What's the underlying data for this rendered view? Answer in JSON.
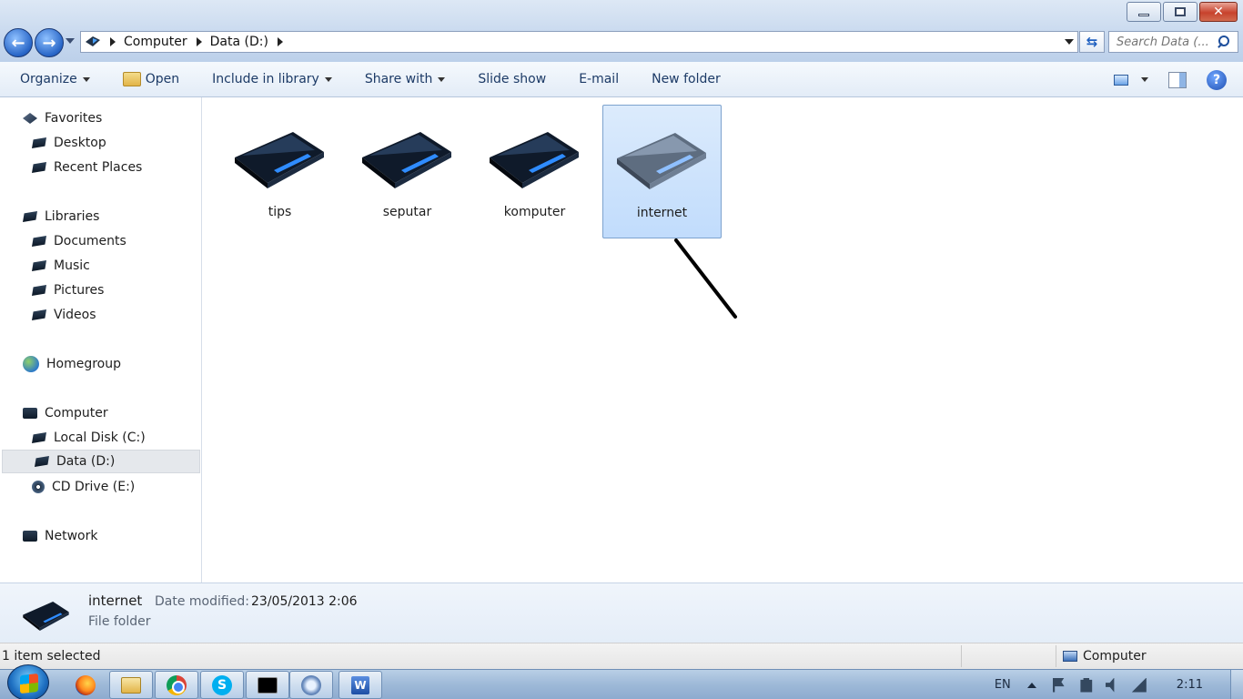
{
  "window": {
    "buttons": {
      "minimize": "minimize",
      "restore": "restore",
      "close": "✕"
    }
  },
  "address": {
    "crumbs": [
      "Computer",
      "Data (D:)"
    ],
    "search_placeholder": "Search Data (..."
  },
  "toolbar": {
    "organize": "Organize",
    "open": "Open",
    "include_in_library": "Include in library",
    "share_with": "Share with",
    "slide_show": "Slide show",
    "email": "E-mail",
    "new_folder": "New folder",
    "help": "?"
  },
  "nav": {
    "favorites": "Favorites",
    "desktop": "Desktop",
    "recent_places": "Recent Places",
    "libraries": "Libraries",
    "documents": "Documents",
    "music": "Music",
    "pictures": "Pictures",
    "videos": "Videos",
    "homegroup": "Homegroup",
    "computer": "Computer",
    "local_disk": "Local Disk (C:)",
    "data_drive": "Data (D:)",
    "cd_drive": "CD Drive (E:)",
    "network": "Network"
  },
  "folders": [
    {
      "name": "tips"
    },
    {
      "name": "seputar"
    },
    {
      "name": "komputer"
    },
    {
      "name": "internet",
      "selected": true
    }
  ],
  "details": {
    "name": "internet",
    "date_label": "Date modified:",
    "date_value": "23/05/2013 2:06",
    "type": "File folder"
  },
  "status": {
    "selection": "1 item selected",
    "location": "Computer"
  },
  "taskbar": {
    "language": "EN",
    "clock": "2:11",
    "skype_glyph": "S",
    "word_glyph": "W"
  },
  "colors": {
    "selection_bg": "#cce0fb",
    "accent": "#1e5fbf",
    "taskbar": "#9eb9d8"
  }
}
